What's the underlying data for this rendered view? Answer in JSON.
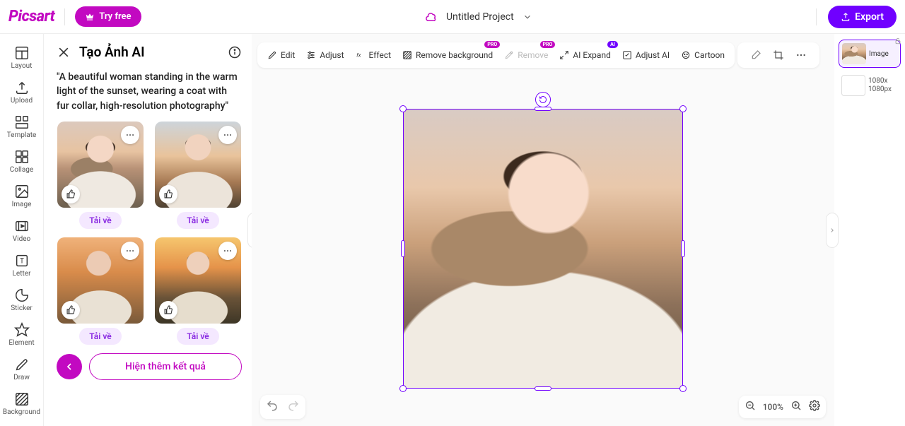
{
  "header": {
    "logo": "Picsart",
    "try_free": "Try free",
    "project_name": "Untitled Project",
    "export": "Export"
  },
  "rail": [
    {
      "key": "layout",
      "label": "Layout"
    },
    {
      "key": "upload",
      "label": "Upload"
    },
    {
      "key": "template",
      "label": "Template"
    },
    {
      "key": "collage",
      "label": "Collage"
    },
    {
      "key": "image",
      "label": "Image"
    },
    {
      "key": "video",
      "label": "Video"
    },
    {
      "key": "letter",
      "label": "Letter"
    },
    {
      "key": "sticker",
      "label": "Sticker"
    },
    {
      "key": "element",
      "label": "Element"
    },
    {
      "key": "draw",
      "label": "Draw"
    },
    {
      "key": "background",
      "label": "Background"
    }
  ],
  "panel": {
    "title": "Tạo Ảnh AI",
    "prompt": "\"A beautiful woman standing in the warm light of the sunset, wearing a coat with fur collar, high-resolution photography\"",
    "download_label": "Tải về",
    "more_results": "Hiện thêm kết quả"
  },
  "toolbar": {
    "edit": "Edit",
    "adjust": "Adjust",
    "effect": "Effect",
    "remove_bg": "Remove background",
    "remove": "Remove",
    "ai_expand": "AI Expand",
    "adjust_ai": "Adjust AI",
    "cartoon": "Cartoon",
    "pro": "PRO",
    "ai": "AI"
  },
  "zoom": {
    "value": "100%"
  },
  "layers": {
    "image_label": "Image",
    "canvas_dim1": "1080x",
    "canvas_dim2": "1080px"
  }
}
